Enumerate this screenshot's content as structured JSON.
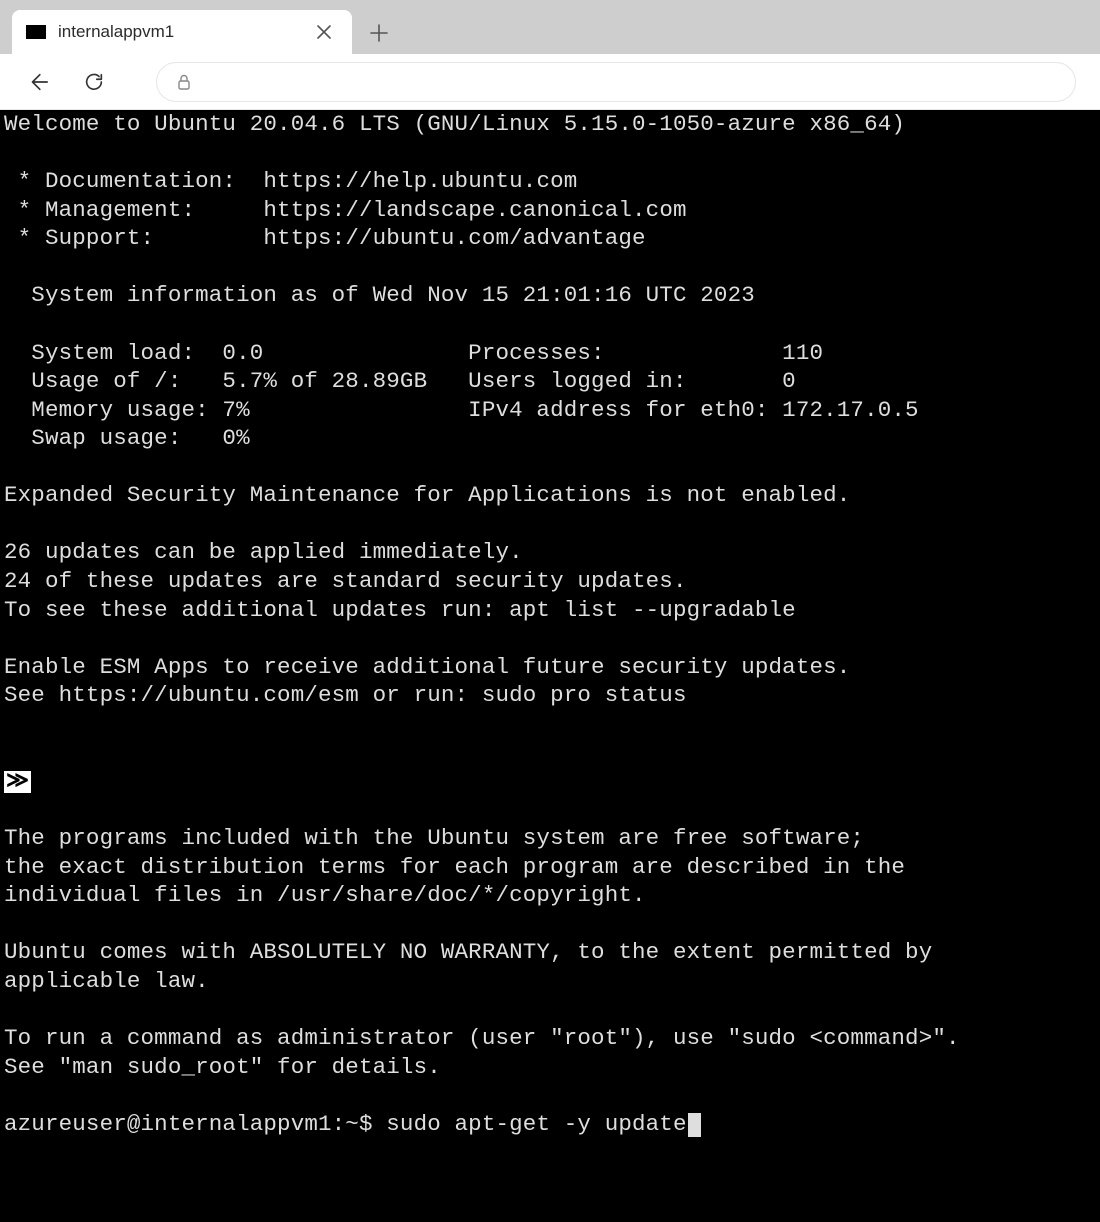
{
  "browser": {
    "tab_title": "internalappvm1"
  },
  "terminal": {
    "welcome": "Welcome to Ubuntu 20.04.6 LTS (GNU/Linux 5.15.0-1050-azure x86_64)",
    "links": {
      "doc_label": " * Documentation:  ",
      "doc_url": "https://help.ubuntu.com",
      "mgmt_label": " * Management:     ",
      "mgmt_url": "https://landscape.canonical.com",
      "sup_label": " * Support:        ",
      "sup_url": "https://ubuntu.com/advantage"
    },
    "sysinfo_header": "  System information as of Wed Nov 15 21:01:16 UTC 2023",
    "sysinfo": {
      "line1": "  System load:  0.0               Processes:             110",
      "line2": "  Usage of /:   5.7% of 28.89GB   Users logged in:       0",
      "line3": "  Memory usage: 7%                IPv4 address for eth0: 172.17.0.5",
      "line4": "  Swap usage:   0%"
    },
    "esm_disabled": "Expanded Security Maintenance for Applications is not enabled.",
    "updates": {
      "line1": "26 updates can be applied immediately.",
      "line2": "24 of these updates are standard security updates.",
      "line3": "To see these additional updates run: apt list --upgradable"
    },
    "esm_enable": {
      "line1": "Enable ESM Apps to receive additional future security updates.",
      "line2": "See https://ubuntu.com/esm or run: sudo pro status"
    },
    "chevrons": "≫",
    "programs": {
      "line1": "The programs included with the Ubuntu system are free software;",
      "line2": "the exact distribution terms for each program are described in the",
      "line3": "individual files in /usr/share/doc/*/copyright."
    },
    "warranty": {
      "line1": "Ubuntu comes with ABSOLUTELY NO WARRANTY, to the extent permitted by",
      "line2": "applicable law."
    },
    "sudo_note": {
      "line1": "To run a command as administrator (user \"root\"), use \"sudo <command>\".",
      "line2": "See \"man sudo_root\" for details."
    },
    "prompt": "azureuser@internalappvm1:~$ ",
    "command": "sudo apt-get -y update"
  }
}
